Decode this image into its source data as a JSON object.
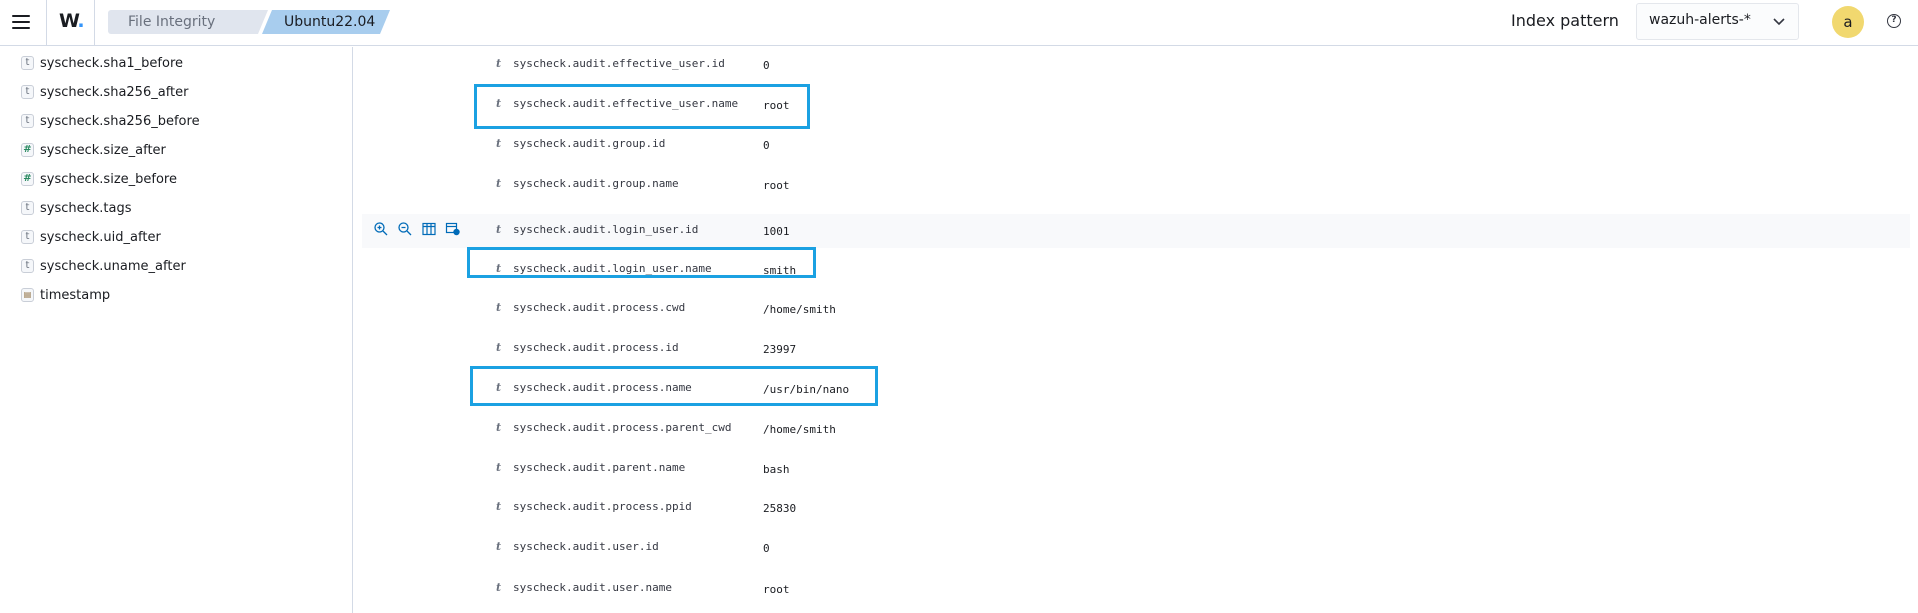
{
  "header": {
    "logo": "W",
    "breadcrumbs": [
      "File Integrity M...",
      "Ubuntu22.04"
    ],
    "index_pattern_label": "Index pattern",
    "index_pattern_value": "wazuh-alerts-*",
    "avatar_initial": "a",
    "help_glyph": "?"
  },
  "sidebar": {
    "fields": [
      {
        "type": "t",
        "name": "syscheck.sha1_before"
      },
      {
        "type": "t",
        "name": "syscheck.sha256_after"
      },
      {
        "type": "t",
        "name": "syscheck.sha256_before"
      },
      {
        "type": "#",
        "name": "syscheck.size_after"
      },
      {
        "type": "#",
        "name": "syscheck.size_before"
      },
      {
        "type": "t",
        "name": "syscheck.tags"
      },
      {
        "type": "t",
        "name": "syscheck.uid_after"
      },
      {
        "type": "t",
        "name": "syscheck.uname_after"
      },
      {
        "type": "date",
        "name": "timestamp"
      }
    ]
  },
  "doc_table": {
    "rows": [
      {
        "type": "t",
        "field": "syscheck.audit.effective_user.id",
        "value": "0"
      },
      {
        "type": "t",
        "field": "syscheck.audit.effective_user.name",
        "value": "root"
      },
      {
        "type": "t",
        "field": "syscheck.audit.group.id",
        "value": "0"
      },
      {
        "type": "t",
        "field": "syscheck.audit.group.name",
        "value": "root"
      },
      {
        "type": "t",
        "field": "syscheck.audit.login_user.id",
        "value": "1001"
      },
      {
        "type": "t",
        "field": "syscheck.audit.login_user.name",
        "value": "smith"
      },
      {
        "type": "t",
        "field": "syscheck.audit.process.cwd",
        "value": "/home/smith"
      },
      {
        "type": "t",
        "field": "syscheck.audit.process.id",
        "value": "23997"
      },
      {
        "type": "t",
        "field": "syscheck.audit.process.name",
        "value": "/usr/bin/nano"
      },
      {
        "type": "t",
        "field": "syscheck.audit.process.parent_cwd",
        "value": "/home/smith"
      },
      {
        "type": "t",
        "field": "syscheck.audit.parent.name",
        "value": "bash"
      },
      {
        "type": "t",
        "field": "syscheck.audit.process.ppid",
        "value": "25830"
      },
      {
        "type": "t",
        "field": "syscheck.audit.user.id",
        "value": "0"
      },
      {
        "type": "t",
        "field": "syscheck.audit.user.name",
        "value": "root"
      }
    ],
    "row_actions": [
      "zoom-in-icon",
      "zoom-out-icon",
      "toggle-column-icon",
      "filter-exists-icon"
    ]
  },
  "colors": {
    "highlight_box": "#1ba1e2",
    "accent": "#006bb8"
  }
}
